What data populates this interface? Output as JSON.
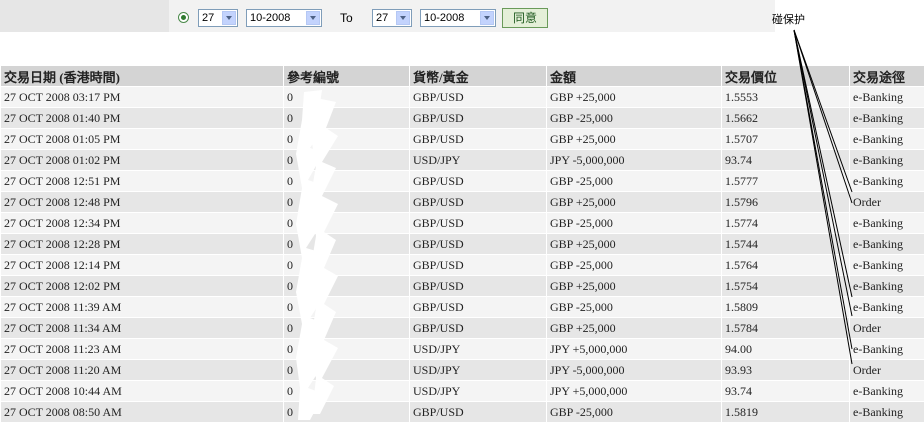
{
  "filter": {
    "from_day": "27",
    "from_month": "10-2008",
    "to_label": "To",
    "to_day": "27",
    "to_month": "10-2008",
    "submit_label": "同意"
  },
  "annotation": {
    "text": "碰保护"
  },
  "table": {
    "headers": [
      "交易日期 (香港時間)",
      "參考編號",
      "貨幣/黃金",
      "金額",
      "交易價位",
      "交易途徑"
    ],
    "rows": [
      [
        "27 OCT 2008 03:17 PM",
        "0",
        "GBP/USD",
        "GBP +25,000",
        "1.5553",
        "e-Banking"
      ],
      [
        "27 OCT 2008 01:40 PM",
        "0",
        "GBP/USD",
        "GBP -25,000",
        "1.5662",
        "e-Banking"
      ],
      [
        "27 OCT 2008 01:05 PM",
        "0",
        "GBP/USD",
        "GBP +25,000",
        "1.5707",
        "e-Banking"
      ],
      [
        "27 OCT 2008 01:02 PM",
        "0",
        "USD/JPY",
        "JPY -5,000,000",
        "93.74",
        "e-Banking"
      ],
      [
        "27 OCT 2008 12:51 PM",
        "0",
        "GBP/USD",
        "GBP -25,000",
        "1.5777",
        "e-Banking"
      ],
      [
        "27 OCT 2008 12:48 PM",
        "0",
        "GBP/USD",
        "GBP +25,000",
        "1.5796",
        "Order"
      ],
      [
        "27 OCT 2008 12:34 PM",
        "0",
        "GBP/USD",
        "GBP -25,000",
        "1.5774",
        "e-Banking"
      ],
      [
        "27 OCT 2008 12:28 PM",
        "0",
        "GBP/USD",
        "GBP +25,000",
        "1.5744",
        "e-Banking"
      ],
      [
        "27 OCT 2008 12:14 PM",
        "0",
        "GBP/USD",
        "GBP -25,000",
        "1.5764",
        "e-Banking"
      ],
      [
        "27 OCT 2008 12:02 PM",
        "0",
        "GBP/USD",
        "GBP +25,000",
        "1.5754",
        "e-Banking"
      ],
      [
        "27 OCT 2008 11:39 AM",
        "0",
        "GBP/USD",
        "GBP -25,000",
        "1.5809",
        "e-Banking"
      ],
      [
        "27 OCT 2008 11:34 AM",
        "0",
        "GBP/USD",
        "GBP +25,000",
        "1.5784",
        "Order"
      ],
      [
        "27 OCT 2008 11:23 AM",
        "0",
        "USD/JPY",
        "JPY +5,000,000",
        "94.00",
        "e-Banking"
      ],
      [
        "27 OCT 2008 11:20 AM",
        "0",
        "USD/JPY",
        "JPY -5,000,000",
        "93.93",
        "Order"
      ],
      [
        "27 OCT 2008 10:44 AM",
        "0",
        "USD/JPY",
        "JPY +5,000,000",
        "93.74",
        "e-Banking"
      ],
      [
        "27 OCT 2008 08:50 AM",
        "0",
        "GBP/USD",
        "GBP -25,000",
        "1.5819",
        "e-Banking"
      ]
    ]
  }
}
